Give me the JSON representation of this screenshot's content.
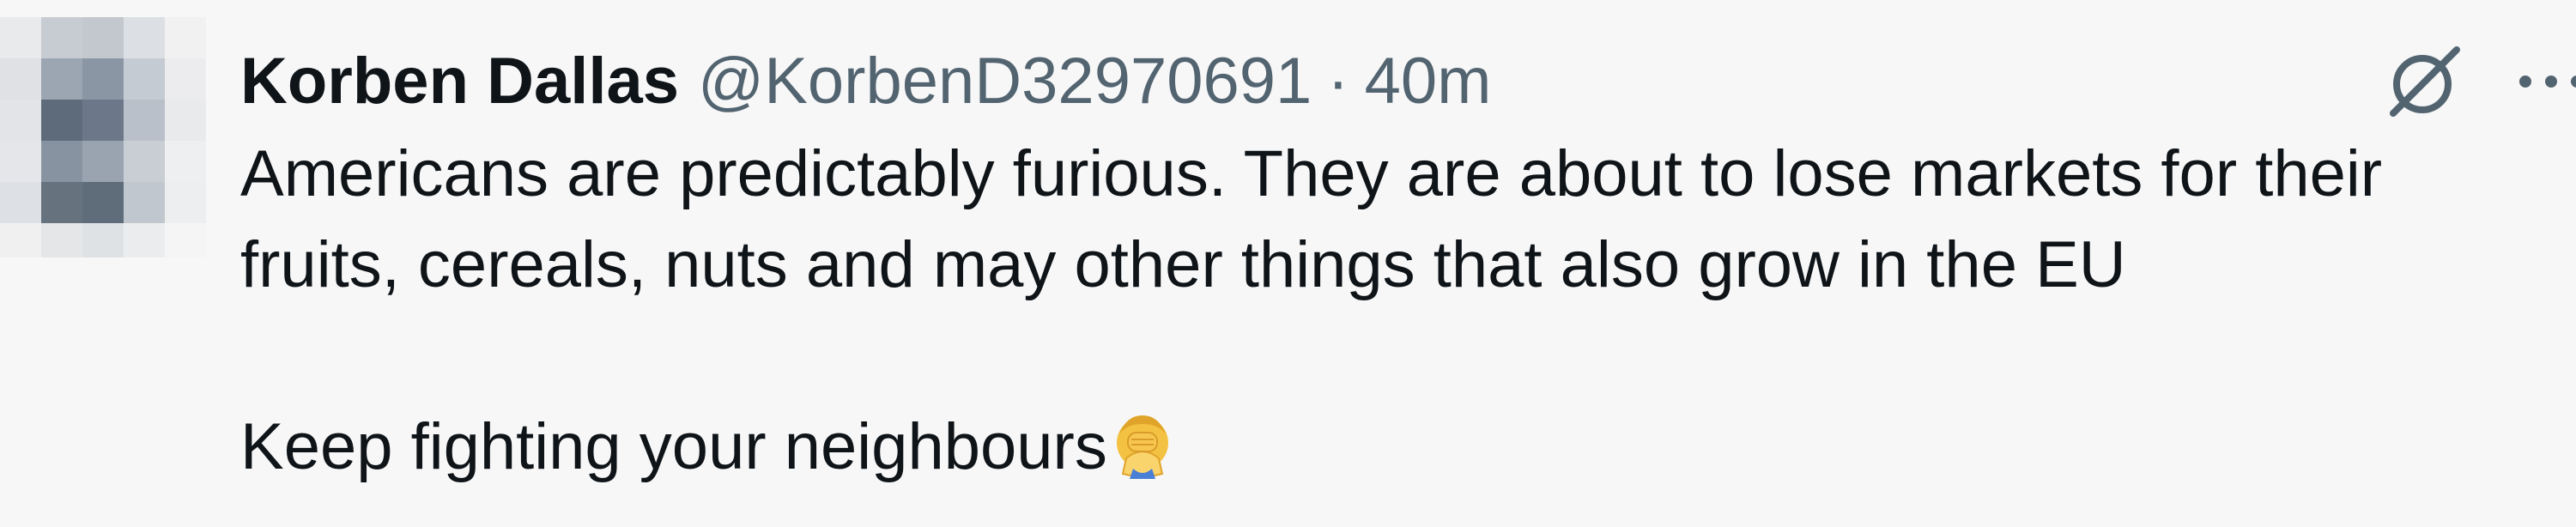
{
  "tweet": {
    "author_name": "Korben Dallas",
    "handle": "@KorbenD32970691",
    "separator": "·",
    "timestamp": "40m",
    "text_line_1": "Americans are predictably furious. They are about to lose markets for their fruits, cereals, nuts and may other things that also grow in the EU",
    "text_line_2": "Keep fighting your neighbours",
    "emoji_icon": "facepalm-emoji"
  },
  "icons": {
    "grok": "grok-icon",
    "more": "more-icon"
  },
  "colors": {
    "background": "#f7f7f7",
    "text_primary": "#0f1419",
    "text_secondary": "#536471"
  }
}
